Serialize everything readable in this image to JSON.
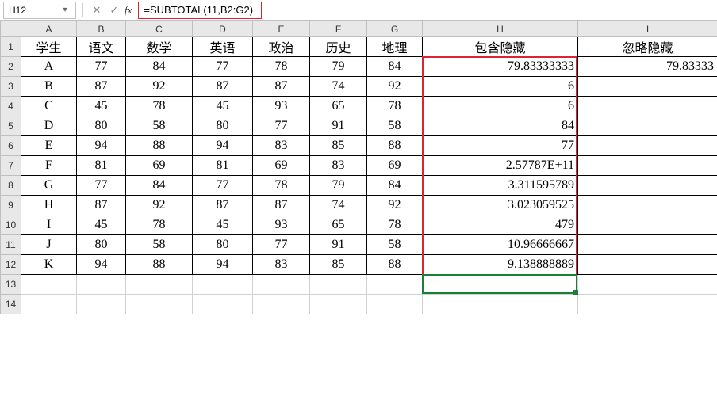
{
  "nameBox": "H12",
  "formula": "=SUBTOTAL(11,B2:G2)",
  "cols": [
    "A",
    "B",
    "C",
    "D",
    "E",
    "F",
    "G",
    "H",
    "I"
  ],
  "rows": [
    "1",
    "2",
    "3",
    "4",
    "5",
    "6",
    "7",
    "8",
    "9",
    "10",
    "11",
    "12",
    "13",
    "14"
  ],
  "headers": {
    "A": "学生",
    "B": "语文",
    "C": "数学",
    "D": "英语",
    "E": "政治",
    "F": "历史",
    "G": "地理",
    "H": "包含隐藏",
    "I": "忽略隐藏"
  },
  "data": [
    {
      "s": "A",
      "v": [
        "77",
        "84",
        "77",
        "78",
        "79",
        "84"
      ],
      "h": "79.83333333",
      "i": "79.83333"
    },
    {
      "s": "B",
      "v": [
        "87",
        "92",
        "87",
        "87",
        "74",
        "92"
      ],
      "h": "6",
      "i": ""
    },
    {
      "s": "C",
      "v": [
        "45",
        "78",
        "45",
        "93",
        "65",
        "78"
      ],
      "h": "6",
      "i": ""
    },
    {
      "s": "D",
      "v": [
        "80",
        "58",
        "80",
        "77",
        "91",
        "58"
      ],
      "h": "84",
      "i": ""
    },
    {
      "s": "E",
      "v": [
        "94",
        "88",
        "94",
        "83",
        "85",
        "88"
      ],
      "h": "77",
      "i": ""
    },
    {
      "s": "F",
      "v": [
        "81",
        "69",
        "81",
        "69",
        "83",
        "69"
      ],
      "h": "2.57787E+11",
      "i": ""
    },
    {
      "s": "G",
      "v": [
        "77",
        "84",
        "77",
        "78",
        "79",
        "84"
      ],
      "h": "3.311595789",
      "i": ""
    },
    {
      "s": "H",
      "v": [
        "87",
        "92",
        "87",
        "87",
        "74",
        "92"
      ],
      "h": "3.023059525",
      "i": ""
    },
    {
      "s": "I",
      "v": [
        "45",
        "78",
        "45",
        "93",
        "65",
        "78"
      ],
      "h": "479",
      "i": ""
    },
    {
      "s": "J",
      "v": [
        "80",
        "58",
        "80",
        "77",
        "91",
        "58"
      ],
      "h": "10.96666667",
      "i": ""
    },
    {
      "s": "K",
      "v": [
        "94",
        "88",
        "94",
        "83",
        "85",
        "88"
      ],
      "h": "9.138888889",
      "i": ""
    }
  ]
}
